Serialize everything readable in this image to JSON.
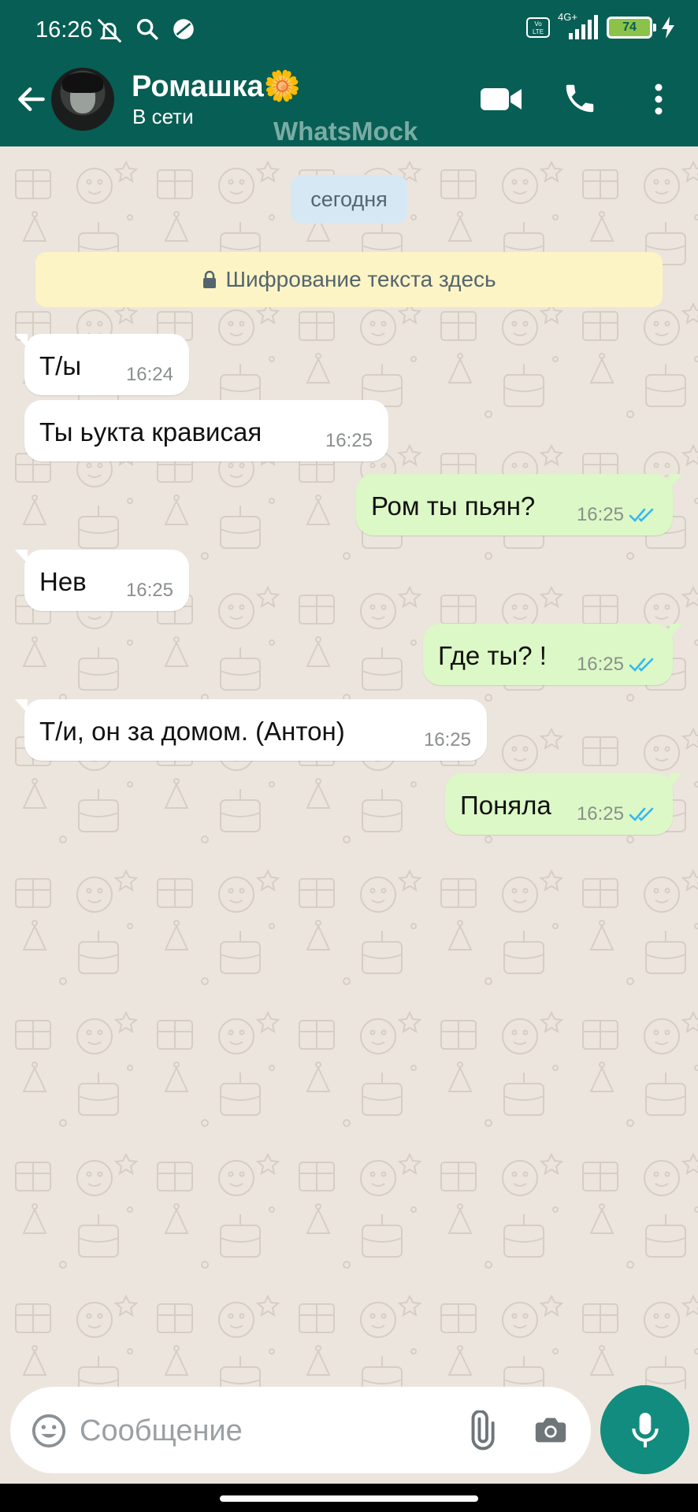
{
  "status_bar": {
    "time": "16:26",
    "network": "4G+",
    "battery": "74"
  },
  "header": {
    "contact_name": "Ромашка🌼",
    "contact_status": "В сети",
    "watermark": "WhatsMock"
  },
  "chat": {
    "date_chip": "сегодня",
    "encryption_note": "Шифрование текста здесь",
    "messages": [
      {
        "direction": "in",
        "text": "Т/ы",
        "time": "16:24"
      },
      {
        "direction": "in",
        "text": "Ты ьукта крависая",
        "time": "16:25"
      },
      {
        "direction": "out",
        "text": "Ром ты пьян?",
        "time": "16:25",
        "read": true
      },
      {
        "direction": "in",
        "text": "Нев",
        "time": "16:25"
      },
      {
        "direction": "out",
        "text": "Где ты? !",
        "time": "16:25",
        "read": true
      },
      {
        "direction": "in",
        "text": "Т/и, он за домом. (Антон)",
        "time": "16:25"
      },
      {
        "direction": "out",
        "text": "Поняла",
        "time": "16:25",
        "read": true
      }
    ]
  },
  "composer": {
    "placeholder": "Сообщение"
  },
  "colors": {
    "header": "#075e54",
    "chat_bg": "#ece5dd",
    "outgoing": "#dcf8c6",
    "incoming": "#ffffff",
    "accent": "#128c7e",
    "read_ticks": "#34b7f1"
  },
  "icons": [
    "back-arrow-icon",
    "video-call-icon",
    "phone-icon",
    "more-vert-icon",
    "lock-icon",
    "emoji-icon",
    "attach-icon",
    "camera-icon",
    "mic-icon",
    "double-check-icon"
  ]
}
